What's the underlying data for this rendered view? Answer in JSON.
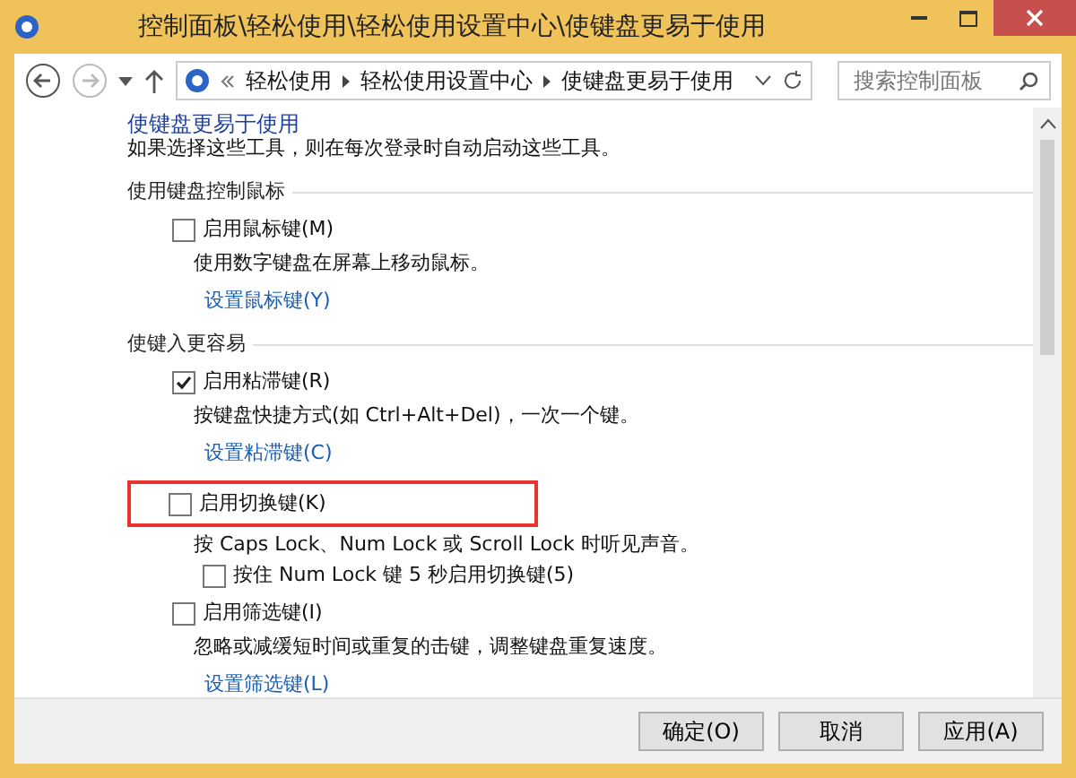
{
  "window": {
    "title": "控制面板\\轻松使用\\轻松使用设置中心\\使键盘更易于使用"
  },
  "address_bar": {
    "crumbs": [
      "轻松使用",
      "轻松使用设置中心",
      "使键盘更易于使用"
    ]
  },
  "search": {
    "placeholder": "搜索控制面板"
  },
  "top_link": "使键盘更易于使用",
  "intro": "如果选择这些工具，则在每次登录时自动启动这些工具。",
  "sections": [
    {
      "heading": "使用键盘控制鼠标",
      "options": [
        {
          "label": "启用鼠标键(M)",
          "checked": false,
          "highlighted": false,
          "description": "使用数字键盘在屏幕上移动鼠标。",
          "link": "设置鼠标键(Y)"
        }
      ]
    },
    {
      "heading": "使键入更容易",
      "options": [
        {
          "label": "启用粘滞键(R)",
          "checked": true,
          "highlighted": false,
          "description": "按键盘快捷方式(如 Ctrl+Alt+Del)，一次一个键。",
          "link": "设置粘滞键(C)"
        },
        {
          "label": "启用切换键(K)",
          "checked": false,
          "highlighted": true,
          "description": "按 Caps Lock、Num Lock 或 Scroll Lock 时听见声音。",
          "sub_options": [
            {
              "label": "按住 Num Lock 键 5 秒启用切换键(5)",
              "checked": false
            }
          ]
        },
        {
          "label": "启用筛选键(I)",
          "checked": false,
          "highlighted": false,
          "description": "忽略或减缓短时间或重复的击键，调整键盘重复速度。",
          "link": "设置筛选键(L)"
        }
      ]
    }
  ],
  "buttons": [
    "确定(O)",
    "取消",
    "应用(A)"
  ]
}
